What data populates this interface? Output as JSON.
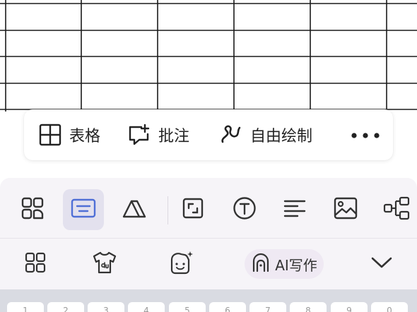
{
  "insert_panel": {
    "items": [
      {
        "label": "表格",
        "icon": "table-icon"
      },
      {
        "label": "批注",
        "icon": "comment-add-icon"
      },
      {
        "label": "自由绘制",
        "icon": "freehand-draw-icon"
      }
    ],
    "more_icon": "more-dots-icon"
  },
  "tool_row": {
    "icons": [
      "apps-grid-icon",
      "keyboard-icon",
      "shapes-icon",
      "fullscreen-icon",
      "text-icon",
      "align-left-icon",
      "image-icon",
      "mindmap-icon"
    ],
    "active_index": 1
  },
  "keyboard_toolbar": {
    "icons": [
      "grid-menu-icon",
      "tshirt-skin-icon",
      "emoji-sticker-icon"
    ],
    "ai_label": "AI写作",
    "ai_icon": "ai-assistant-icon",
    "collapse_icon": "chevron-down-icon"
  },
  "keyboard": {
    "number_keys": [
      "1",
      "2",
      "3",
      "4",
      "5",
      "6",
      "7",
      "8",
      "9",
      "0"
    ]
  },
  "colors": {
    "accent": "#4f6fd6",
    "active_bg": "#e3e1ee",
    "panel_bg": "#f6f4f8",
    "text": "#222222"
  }
}
